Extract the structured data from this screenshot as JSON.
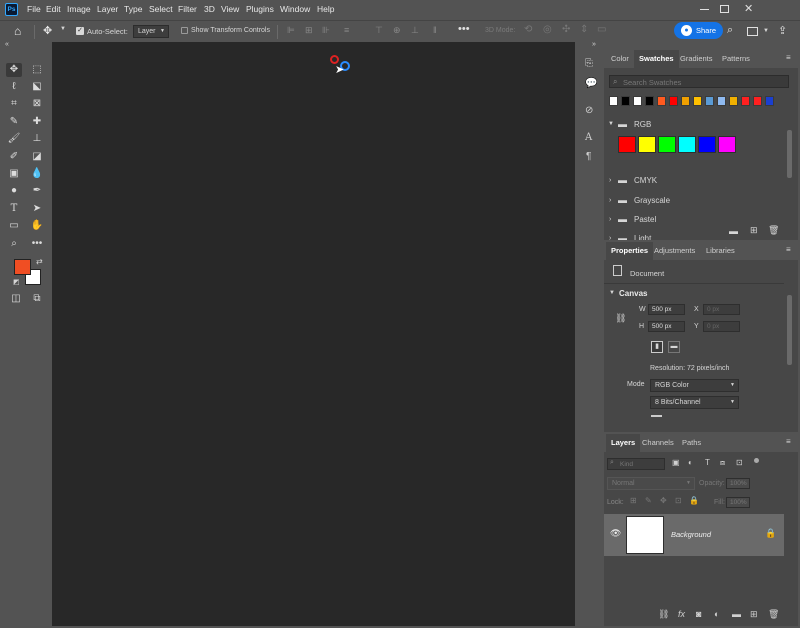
{
  "app": {
    "logo": "Ps"
  },
  "menu": [
    "File",
    "Edit",
    "Image",
    "Layer",
    "Type",
    "Select",
    "Filter",
    "3D",
    "View",
    "Plugins",
    "Window",
    "Help"
  ],
  "options": {
    "auto_select_label": "Auto-Select:",
    "auto_select_value": "Layer",
    "show_transform_label": "Show Transform Controls",
    "mode_3d_label": "3D Mode:",
    "share_label": "Share"
  },
  "swatches_panel": {
    "tabs": [
      "Color",
      "Swatches",
      "Gradients",
      "Patterns"
    ],
    "search_placeholder": "Search Swatches",
    "recent_colors": [
      "#ffffff",
      "#000000",
      "#ffffff",
      "#000000",
      "#ff5a1f",
      "#ff0000",
      "#f0a000",
      "#ffc000",
      "#5b9bd5",
      "#8fbaf0",
      "#f0b000",
      "#ff2020",
      "#ff2020",
      "#1a3fd0"
    ],
    "folders": [
      "RGB",
      "CMYK",
      "Grayscale",
      "Pastel",
      "Light"
    ],
    "rgb_colors": [
      "#ff0000",
      "#ffff00",
      "#00ff00",
      "#00ffff",
      "#0000ff",
      "#ff00ff"
    ]
  },
  "properties_panel": {
    "tabs": [
      "Properties",
      "Adjustments",
      "Libraries"
    ],
    "document_label": "Document",
    "canvas_label": "Canvas",
    "w_label": "W",
    "w_value": "500 px",
    "h_label": "H",
    "h_value": "500 px",
    "x_label": "X",
    "x_placeholder": "0 px",
    "y_label": "Y",
    "y_placeholder": "0 px",
    "resolution": "Resolution: 72 pixels/inch",
    "mode_label": "Mode",
    "mode_value": "RGB Color",
    "bits_value": "8 Bits/Channel"
  },
  "layers_panel": {
    "tabs": [
      "Layers",
      "Channels",
      "Paths"
    ],
    "filter_placeholder": "Kind",
    "blend_mode": "Normal",
    "opacity_label": "Opacity:",
    "opacity_value": "100%",
    "lock_label": "Lock:",
    "fill_label": "Fill:",
    "fill_value": "100%",
    "layer_name": "Background"
  },
  "colors": {
    "foreground": "#f04e23",
    "background": "#ffffff",
    "share": "#1473e6"
  }
}
